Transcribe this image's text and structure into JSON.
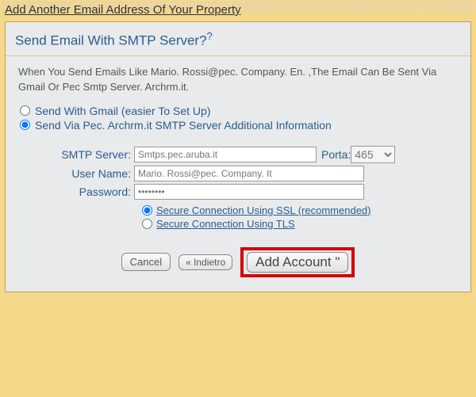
{
  "window_title": "Add Another Email Address Of Your Property",
  "panel": {
    "heading": "Send Email With SMTP Server?",
    "intro": "When You Send Emails Like Mario. Rossi@pec. Company. En. ,The Email Can Be Sent Via Gmail Or Pec Smtp Server. Archrm.it.",
    "option_gmail": "Send With Gmail (easier To Set Up)",
    "option_smtp": "Send Via Pec. Archrm.it SMTP Server Additional Information"
  },
  "form": {
    "smtp_label": "SMTP Server:",
    "smtp_value": "Smtps.pec.aruba.it",
    "porta_label": "Porta:",
    "porta_value": "465",
    "user_label": "User Name:",
    "user_value": "Mario. Rossi@pec. Company. It",
    "pass_label": "Password:",
    "pass_value": "••••••••"
  },
  "security": {
    "ssl": "Secure Connection Using SSL (recommended)",
    "tls": "Secure Connection Using TLS"
  },
  "buttons": {
    "cancel": "Cancel",
    "back": "« Indietro",
    "add": "Add Account \""
  }
}
